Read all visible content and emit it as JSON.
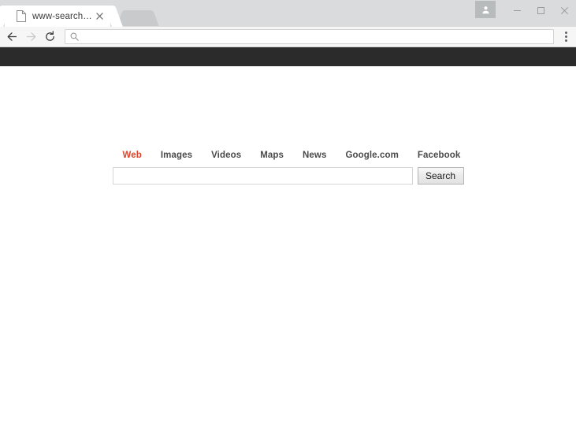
{
  "browser": {
    "tab": {
      "title": "www-searches.net",
      "favicon_icon": "page-icon",
      "close_icon": "close-icon"
    },
    "new_tab_label": "",
    "window_controls": {
      "avatar_icon": "person-icon",
      "minimize_label": "–",
      "maximize_label": "□",
      "close_label": "×"
    },
    "toolbar": {
      "back_icon": "back-arrow-icon",
      "forward_icon": "forward-arrow-icon",
      "reload_icon": "reload-icon",
      "omnibox_icon": "search-icon",
      "omnibox_value": "",
      "omnibox_placeholder": "",
      "menu_icon": "three-dot-menu-icon"
    }
  },
  "page": {
    "topbar": {
      "label": ""
    },
    "nav": {
      "items": [
        {
          "label": "Web",
          "active": true
        },
        {
          "label": "Images",
          "active": false
        },
        {
          "label": "Videos",
          "active": false
        },
        {
          "label": "Maps",
          "active": false
        },
        {
          "label": "News",
          "active": false
        },
        {
          "label": "Google.com",
          "active": false
        },
        {
          "label": "Facebook",
          "active": false
        }
      ],
      "active_color": "#e0432a",
      "inactive_color": "#4a4a4a"
    },
    "search": {
      "value": "",
      "placeholder": "",
      "button_label": "Search"
    }
  }
}
